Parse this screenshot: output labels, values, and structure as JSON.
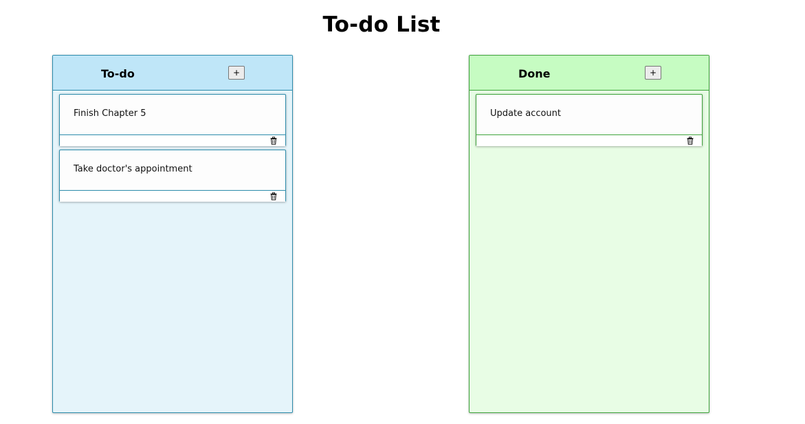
{
  "page": {
    "title": "To-do List"
  },
  "columns": [
    {
      "title": "To-do",
      "add_label": "+",
      "cards": [
        {
          "text": "Finish Chapter 5",
          "delete_icon": "trash-icon"
        },
        {
          "text": "Take doctor's appointment",
          "delete_icon": "trash-icon"
        }
      ],
      "colors": {
        "header": "#bfe6f8",
        "body": "#e5f4fa",
        "border": "#2b8bab"
      }
    },
    {
      "title": "Done",
      "add_label": "+",
      "cards": [
        {
          "text": "Update account",
          "delete_icon": "trash-icon"
        }
      ],
      "colors": {
        "header": "#c6fcc2",
        "body": "#e8fde5",
        "border": "#3da33a"
      }
    }
  ]
}
